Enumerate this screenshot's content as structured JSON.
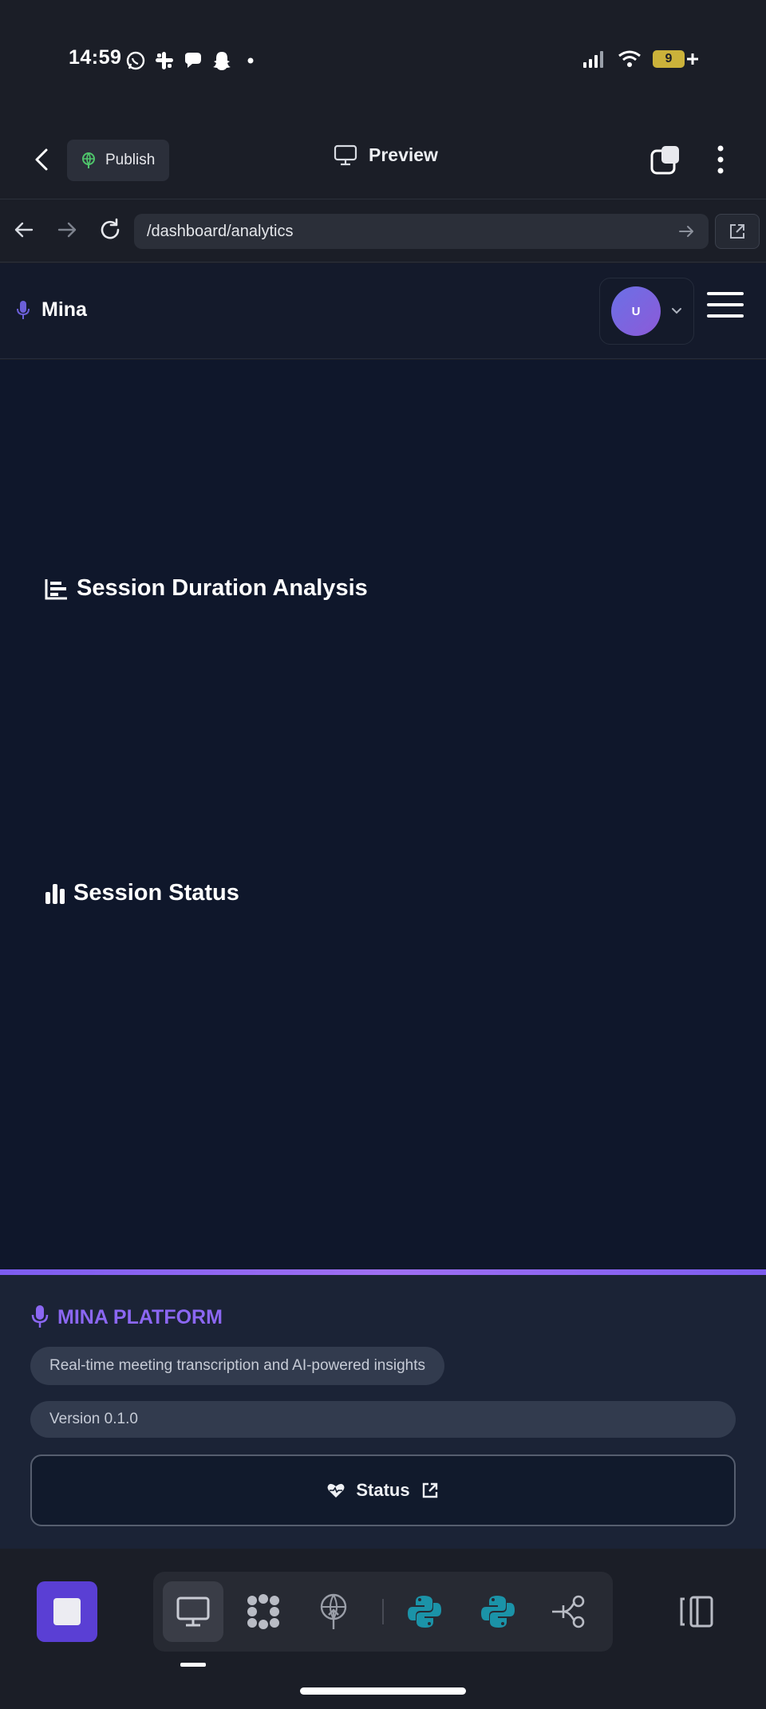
{
  "status_bar": {
    "time": "14:59",
    "battery_level": "9",
    "notification_icons": [
      "whatsapp-icon",
      "slack-icon",
      "chat-bubble-icon",
      "snapchat-icon",
      "dot-icon"
    ]
  },
  "app_header": {
    "publish_label": "Publish",
    "preview_label": "Preview"
  },
  "browser": {
    "url": "/dashboard/analytics"
  },
  "app_nav": {
    "brand_name": "Mina",
    "avatar_initial": "U"
  },
  "main": {
    "sections": [
      {
        "title": "Session Duration Analysis",
        "icon": "bar-chart-horizontal-icon"
      },
      {
        "title": "Session Status",
        "icon": "bar-chart-vertical-icon"
      }
    ]
  },
  "footer": {
    "brand": "MINA PLATFORM",
    "description": "Real-time meeting transcription and AI-powered insights",
    "version": "Version 0.1.0",
    "status_label": "Status"
  },
  "toolbar": {
    "tools": [
      "desktop-icon",
      "atom-icon",
      "deploy-icon",
      "python-icon",
      "python-icon",
      "share-nodes-icon"
    ]
  },
  "colors": {
    "accent": "#7c5cf0",
    "main_bg": "#0f172b",
    "footer_bg": "#1b2336",
    "chrome_bg": "#1b1e27"
  }
}
